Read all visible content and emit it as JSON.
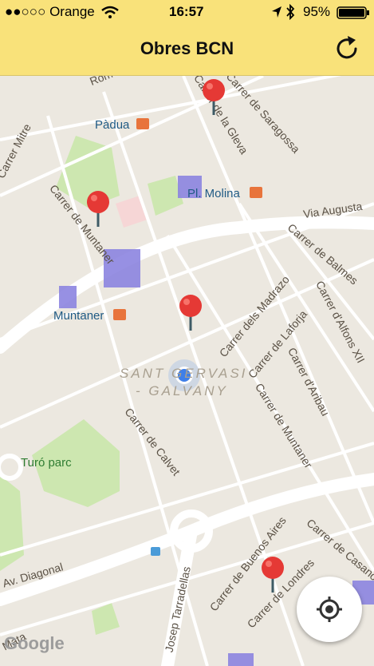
{
  "status_bar": {
    "carrier": "●●○○○ Orange",
    "time": "16:57",
    "battery": "95%"
  },
  "nav": {
    "title": "Obres BCN"
  },
  "map": {
    "streets": [
      "Carrer de Saragossa",
      "Carrer de la Gleva",
      "Carrer de Muntaner",
      "Via Augusta",
      "Carrer de Balmes",
      "Carrer dels Madrazo",
      "Carrer de Laforja",
      "Carrer d'Alfons XII",
      "Carrer d'Aribau",
      "Carrer de Muntaner",
      "Carrer de Calvet",
      "Av. Diagonal",
      "Carrer de Buenos Aires",
      "Carrer de Casanova",
      "Carrer de Londres",
      "Josep Tarradellas",
      "Carrer Mitre",
      "Rom",
      "Mata"
    ],
    "stations": [
      "Pàdua",
      "Pl. Molina",
      "Muntaner"
    ],
    "park": "Turó parc",
    "district": [
      "SANT GERVASI",
      "- GALVANY"
    ],
    "attribution": "Google"
  }
}
